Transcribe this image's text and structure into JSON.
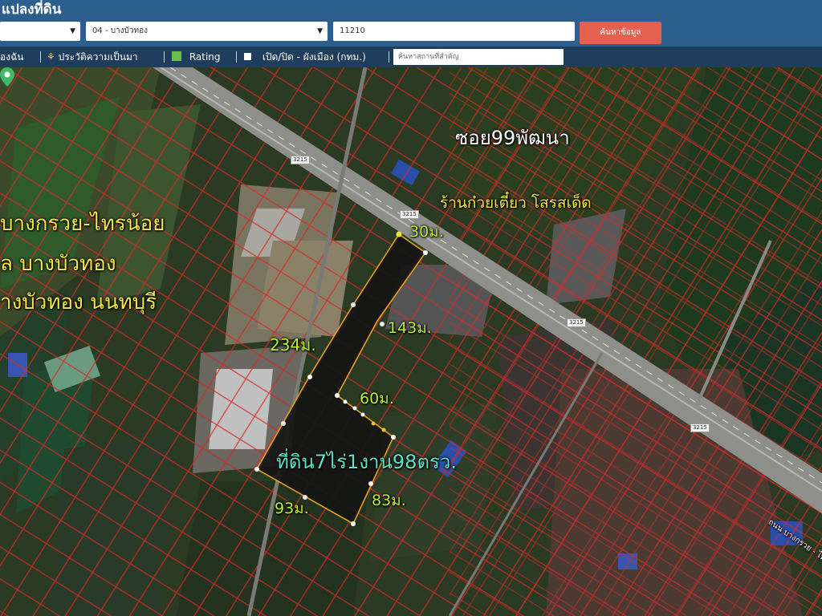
{
  "header": {
    "title": "แปลงที่ดิน",
    "province_select": "",
    "district_select": "04 - บางบัวทอง",
    "postcode_field": "11210",
    "search_button": "ค้นหาข้อมูล"
  },
  "toolbar": {
    "item_mine": "องฉัน",
    "item_history": "ประวัติความเป็นมา",
    "item_rating": "Rating",
    "item_toggle": "เปิด/ปิด - ผังเมือง (กทม.)",
    "search_placeholder": "ค้นหาสถานที่สำคัญ"
  },
  "map": {
    "soi_label": "ซอย99พัฒนา",
    "shop_label": "ร้านก๋วยเตี๋ยว โสรสเด็ด",
    "road_label": "บางกรวย-ไทรน้อย",
    "subdistrict_label": "ล บางบัวทอง",
    "district_label": "างบัวทอง นนทบุรี",
    "dim_30": "30ม.",
    "dim_143": "143ม.",
    "dim_234": "234ม.",
    "dim_60": "60ม.",
    "dim_93": "93ม.",
    "dim_83": "83ม.",
    "area_label": "ที่ดิน7ไร่1งาน98ตรว.",
    "road_code": "3215",
    "road_bottom_right": "ถนน บางกรวย - ไท"
  },
  "colors": {
    "header_bg": "#2d5f8e",
    "toolbar_bg": "#1f3d5c",
    "search_btn": "#e4604f",
    "parcel_line": "#e03030",
    "plot_outline": "#e8a020"
  }
}
